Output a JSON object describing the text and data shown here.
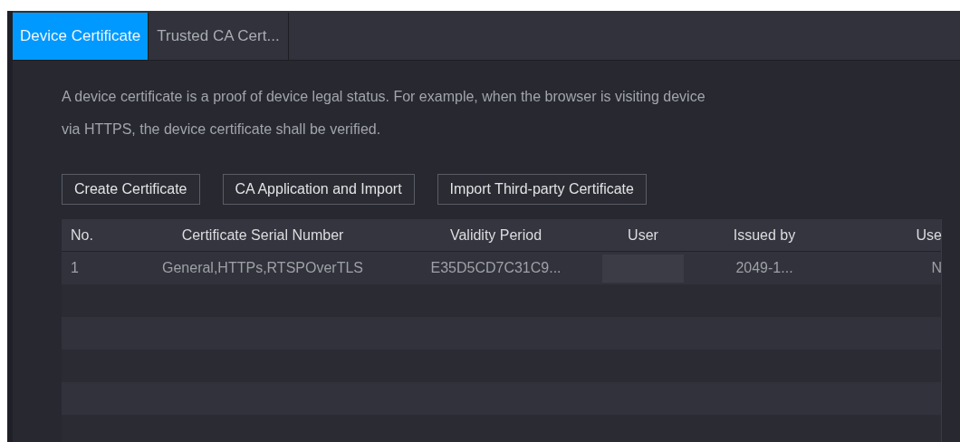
{
  "tabs": [
    {
      "label": "Device Certificate",
      "selected": true
    },
    {
      "label": "Trusted CA Cert...",
      "selected": false
    }
  ],
  "description": "A device certificate is a proof of device legal status. For example, when the browser is visiting device via HTTPS, the device certificate shall be verified.",
  "buttons": [
    "Create Certificate",
    "CA Application and Import",
    "Import Third-party Certificate"
  ],
  "table": {
    "columns": [
      "No.",
      "Certificate Serial Number",
      "Validity Period",
      "User",
      "Issued by",
      "Use"
    ],
    "rows": [
      {
        "cells": [
          "1",
          "General,HTTPs,RTSPOverTLS",
          "E35D5CD7C31C9...",
          null,
          "2049-1...",
          "N"
        ]
      }
    ]
  }
}
